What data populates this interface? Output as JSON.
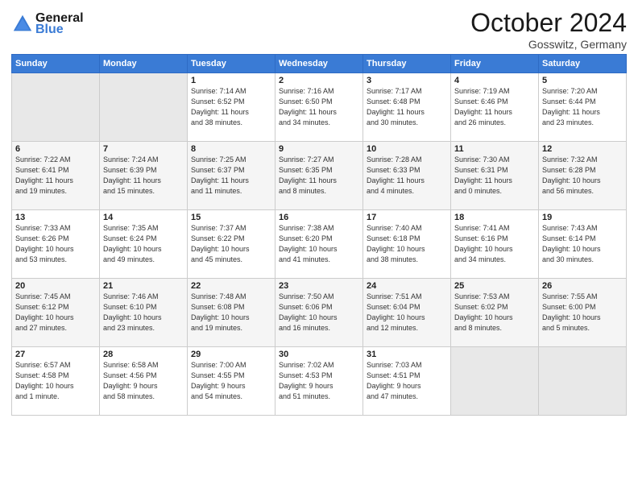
{
  "header": {
    "logo_line1": "General",
    "logo_line2": "Blue",
    "month": "October 2024",
    "location": "Gosswitz, Germany"
  },
  "weekdays": [
    "Sunday",
    "Monday",
    "Tuesday",
    "Wednesday",
    "Thursday",
    "Friday",
    "Saturday"
  ],
  "weeks": [
    [
      {
        "day": "",
        "info": ""
      },
      {
        "day": "",
        "info": ""
      },
      {
        "day": "1",
        "info": "Sunrise: 7:14 AM\nSunset: 6:52 PM\nDaylight: 11 hours\nand 38 minutes."
      },
      {
        "day": "2",
        "info": "Sunrise: 7:16 AM\nSunset: 6:50 PM\nDaylight: 11 hours\nand 34 minutes."
      },
      {
        "day": "3",
        "info": "Sunrise: 7:17 AM\nSunset: 6:48 PM\nDaylight: 11 hours\nand 30 minutes."
      },
      {
        "day": "4",
        "info": "Sunrise: 7:19 AM\nSunset: 6:46 PM\nDaylight: 11 hours\nand 26 minutes."
      },
      {
        "day": "5",
        "info": "Sunrise: 7:20 AM\nSunset: 6:44 PM\nDaylight: 11 hours\nand 23 minutes."
      }
    ],
    [
      {
        "day": "6",
        "info": "Sunrise: 7:22 AM\nSunset: 6:41 PM\nDaylight: 11 hours\nand 19 minutes."
      },
      {
        "day": "7",
        "info": "Sunrise: 7:24 AM\nSunset: 6:39 PM\nDaylight: 11 hours\nand 15 minutes."
      },
      {
        "day": "8",
        "info": "Sunrise: 7:25 AM\nSunset: 6:37 PM\nDaylight: 11 hours\nand 11 minutes."
      },
      {
        "day": "9",
        "info": "Sunrise: 7:27 AM\nSunset: 6:35 PM\nDaylight: 11 hours\nand 8 minutes."
      },
      {
        "day": "10",
        "info": "Sunrise: 7:28 AM\nSunset: 6:33 PM\nDaylight: 11 hours\nand 4 minutes."
      },
      {
        "day": "11",
        "info": "Sunrise: 7:30 AM\nSunset: 6:31 PM\nDaylight: 11 hours\nand 0 minutes."
      },
      {
        "day": "12",
        "info": "Sunrise: 7:32 AM\nSunset: 6:28 PM\nDaylight: 10 hours\nand 56 minutes."
      }
    ],
    [
      {
        "day": "13",
        "info": "Sunrise: 7:33 AM\nSunset: 6:26 PM\nDaylight: 10 hours\nand 53 minutes."
      },
      {
        "day": "14",
        "info": "Sunrise: 7:35 AM\nSunset: 6:24 PM\nDaylight: 10 hours\nand 49 minutes."
      },
      {
        "day": "15",
        "info": "Sunrise: 7:37 AM\nSunset: 6:22 PM\nDaylight: 10 hours\nand 45 minutes."
      },
      {
        "day": "16",
        "info": "Sunrise: 7:38 AM\nSunset: 6:20 PM\nDaylight: 10 hours\nand 41 minutes."
      },
      {
        "day": "17",
        "info": "Sunrise: 7:40 AM\nSunset: 6:18 PM\nDaylight: 10 hours\nand 38 minutes."
      },
      {
        "day": "18",
        "info": "Sunrise: 7:41 AM\nSunset: 6:16 PM\nDaylight: 10 hours\nand 34 minutes."
      },
      {
        "day": "19",
        "info": "Sunrise: 7:43 AM\nSunset: 6:14 PM\nDaylight: 10 hours\nand 30 minutes."
      }
    ],
    [
      {
        "day": "20",
        "info": "Sunrise: 7:45 AM\nSunset: 6:12 PM\nDaylight: 10 hours\nand 27 minutes."
      },
      {
        "day": "21",
        "info": "Sunrise: 7:46 AM\nSunset: 6:10 PM\nDaylight: 10 hours\nand 23 minutes."
      },
      {
        "day": "22",
        "info": "Sunrise: 7:48 AM\nSunset: 6:08 PM\nDaylight: 10 hours\nand 19 minutes."
      },
      {
        "day": "23",
        "info": "Sunrise: 7:50 AM\nSunset: 6:06 PM\nDaylight: 10 hours\nand 16 minutes."
      },
      {
        "day": "24",
        "info": "Sunrise: 7:51 AM\nSunset: 6:04 PM\nDaylight: 10 hours\nand 12 minutes."
      },
      {
        "day": "25",
        "info": "Sunrise: 7:53 AM\nSunset: 6:02 PM\nDaylight: 10 hours\nand 8 minutes."
      },
      {
        "day": "26",
        "info": "Sunrise: 7:55 AM\nSunset: 6:00 PM\nDaylight: 10 hours\nand 5 minutes."
      }
    ],
    [
      {
        "day": "27",
        "info": "Sunrise: 6:57 AM\nSunset: 4:58 PM\nDaylight: 10 hours\nand 1 minute."
      },
      {
        "day": "28",
        "info": "Sunrise: 6:58 AM\nSunset: 4:56 PM\nDaylight: 9 hours\nand 58 minutes."
      },
      {
        "day": "29",
        "info": "Sunrise: 7:00 AM\nSunset: 4:55 PM\nDaylight: 9 hours\nand 54 minutes."
      },
      {
        "day": "30",
        "info": "Sunrise: 7:02 AM\nSunset: 4:53 PM\nDaylight: 9 hours\nand 51 minutes."
      },
      {
        "day": "31",
        "info": "Sunrise: 7:03 AM\nSunset: 4:51 PM\nDaylight: 9 hours\nand 47 minutes."
      },
      {
        "day": "",
        "info": ""
      },
      {
        "day": "",
        "info": ""
      }
    ]
  ]
}
